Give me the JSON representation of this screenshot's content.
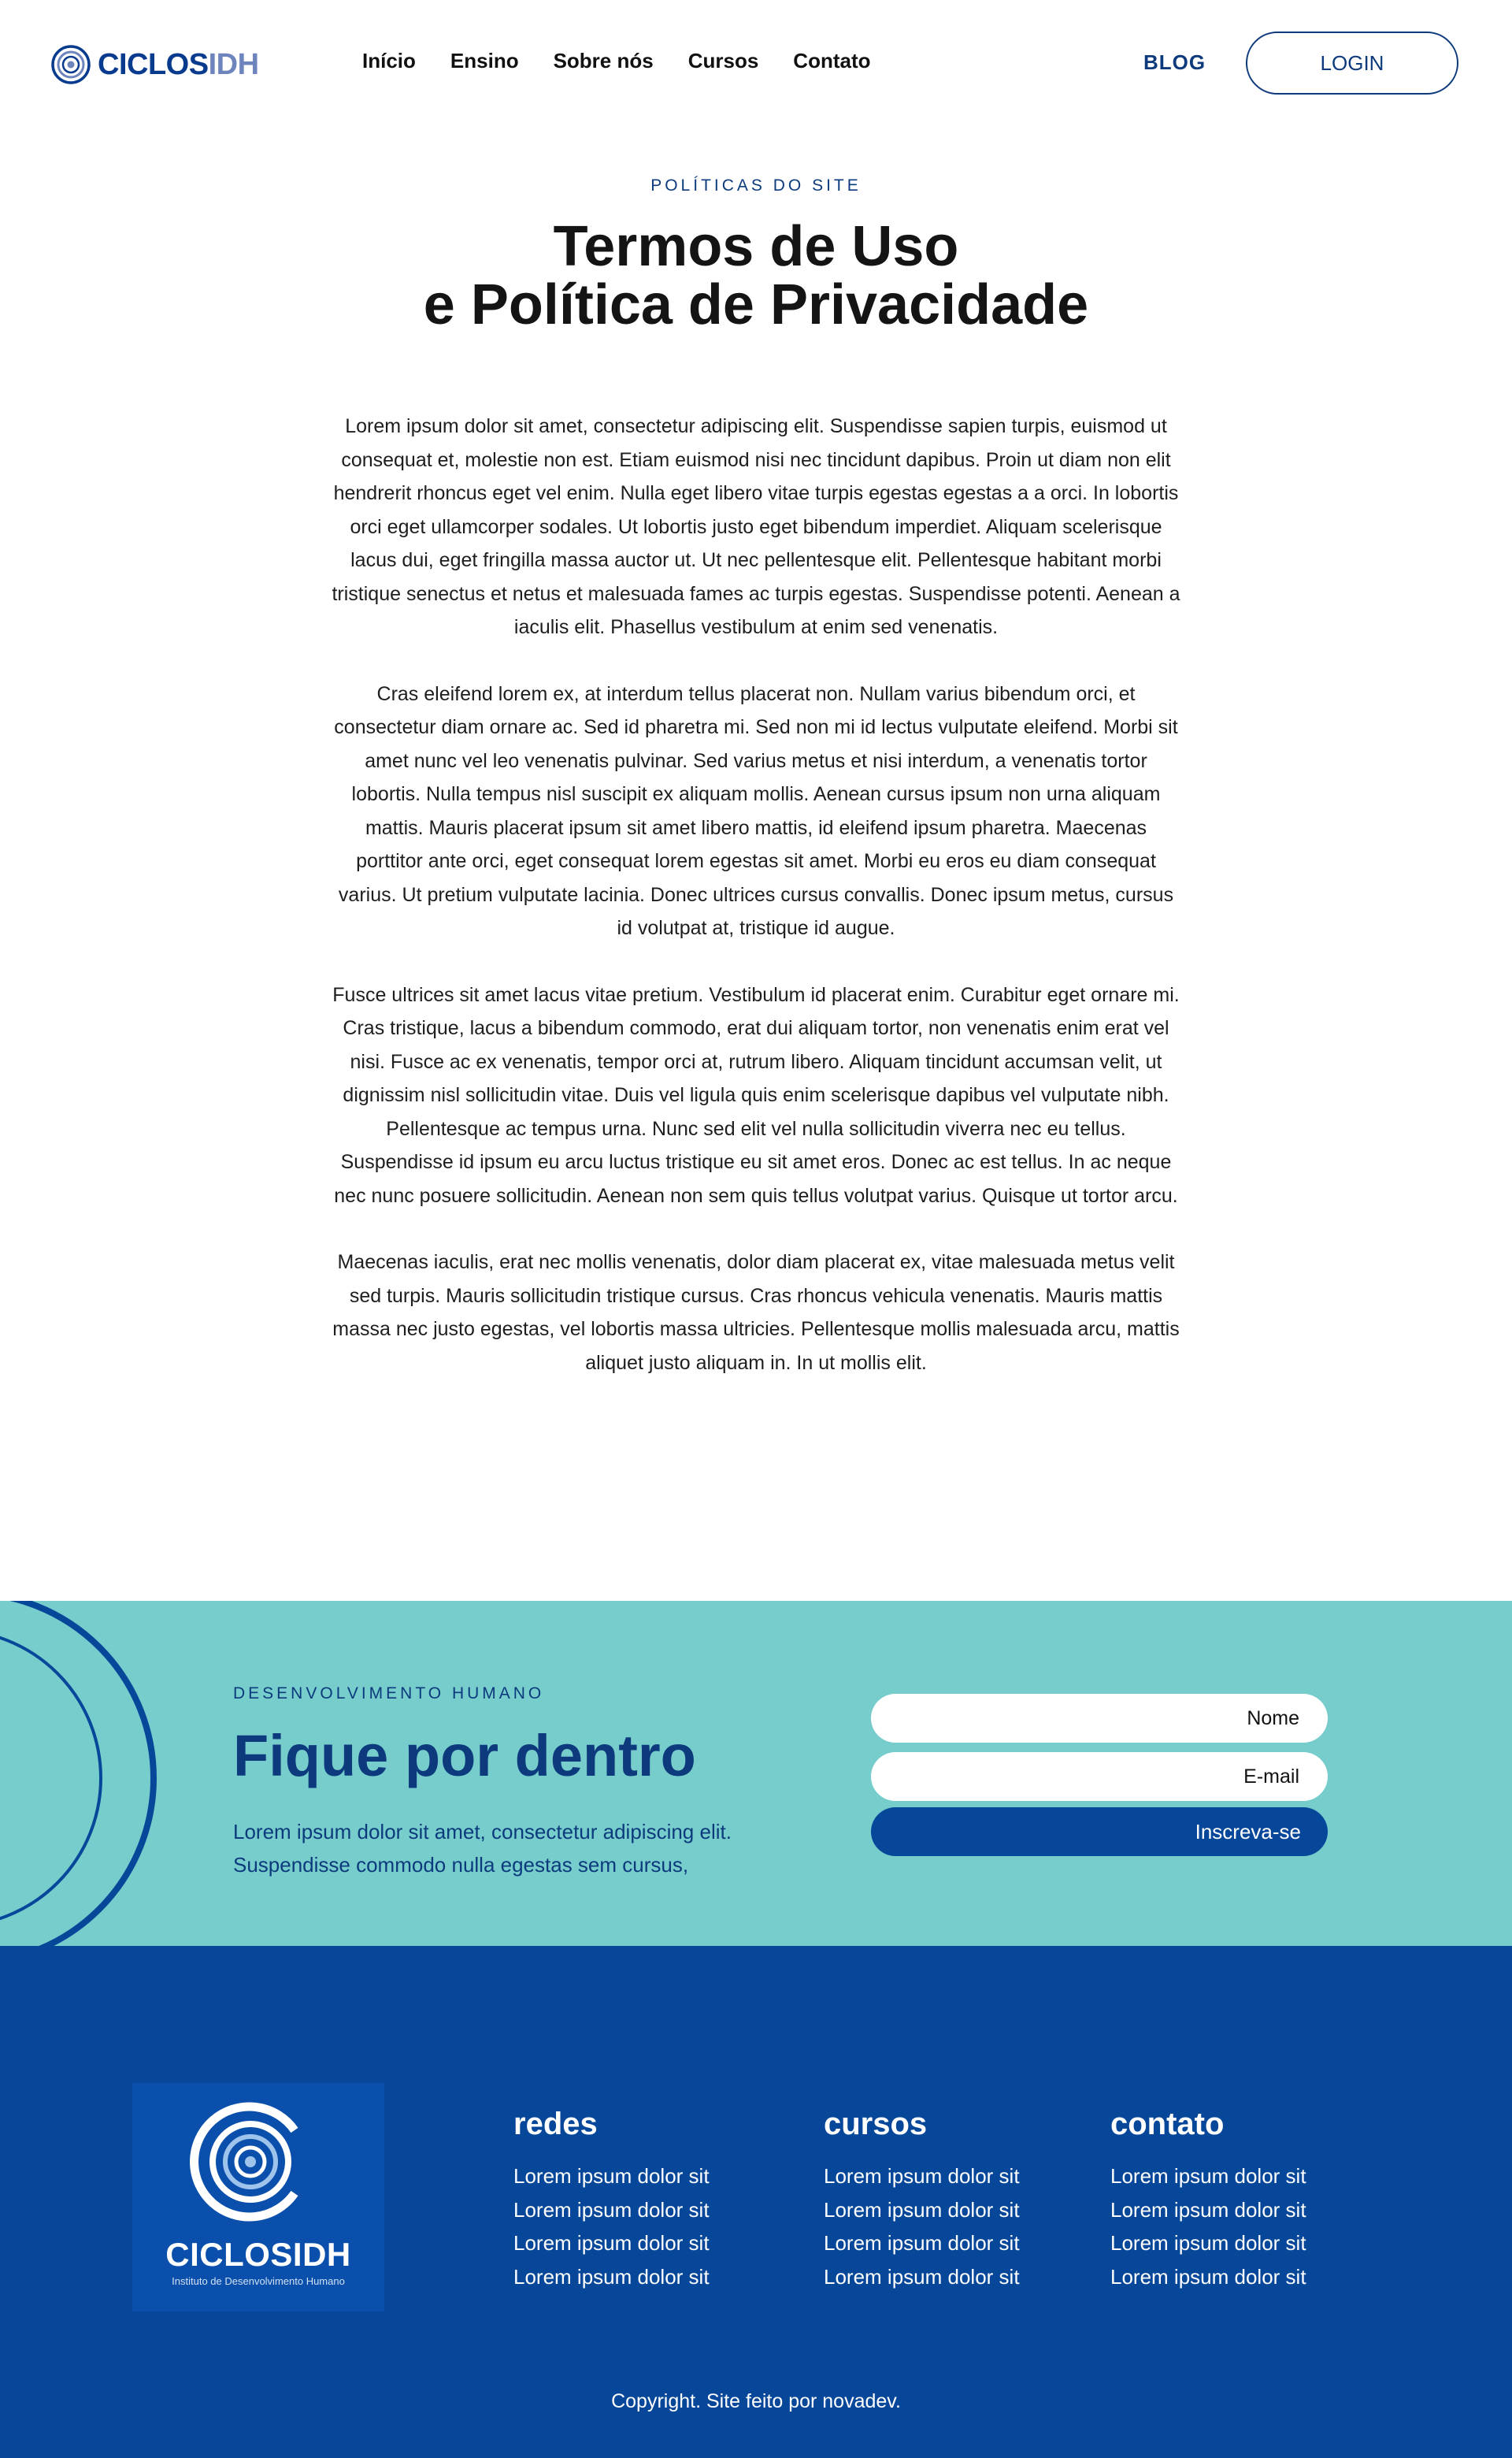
{
  "header": {
    "logo": {
      "primary": "CICLOS",
      "secondary": "IDH"
    },
    "nav": [
      "Início",
      "Ensino",
      "Sobre nós",
      "Cursos",
      "Contato"
    ],
    "blog_label": "BLOG",
    "login_label": "LOGIN"
  },
  "page": {
    "eyebrow": "POLÍTICAS DO SITE",
    "title_line1": "Termos de Uso",
    "title_line2": "e Política de Privacidade",
    "paragraphs": [
      "Lorem ipsum dolor sit amet, consectetur adipiscing elit. Suspendisse sapien turpis, euismod ut consequat et, molestie non est. Etiam euismod nisi nec tincidunt dapibus. Proin ut diam non elit hendrerit rhoncus eget vel enim. Nulla eget libero vitae turpis egestas egestas a a orci. In lobortis orci eget ullamcorper sodales. Ut lobortis justo eget bibendum imperdiet. Aliquam scelerisque lacus dui, eget fringilla massa auctor ut. Ut nec pellentesque elit. Pellentesque habitant morbi tristique senectus et netus et malesuada fames ac turpis egestas. Suspendisse potenti. Aenean a iaculis elit. Phasellus vestibulum at enim sed venenatis.",
      "Cras eleifend lorem ex, at interdum tellus placerat non. Nullam varius bibendum orci, et consectetur diam ornare ac. Sed id pharetra mi. Sed non mi id lectus vulputate eleifend. Morbi sit amet nunc vel leo venenatis pulvinar. Sed varius metus et nisi interdum, a venenatis tortor lobortis. Nulla tempus nisl suscipit ex aliquam mollis. Aenean cursus ipsum non urna aliquam mattis. Mauris placerat ipsum sit amet libero mattis, id eleifend ipsum pharetra. Maecenas porttitor ante orci, eget consequat lorem egestas sit amet. Morbi eu eros eu diam consequat varius. Ut pretium vulputate lacinia. Donec ultrices cursus convallis. Donec ipsum metus, cursus id volutpat at, tristique id augue.",
      "Fusce ultrices sit amet lacus vitae pretium. Vestibulum id placerat enim. Curabitur eget ornare mi. Cras tristique, lacus a bibendum commodo, erat dui aliquam tortor, non venenatis enim erat vel nisi. Fusce ac ex venenatis, tempor orci at, rutrum libero. Aliquam tincidunt accumsan velit, ut dignissim nisl sollicitudin vitae. Duis vel ligula quis enim scelerisque dapibus vel vulputate nibh. Pellentesque ac tempus urna. Nunc sed elit vel nulla sollicitudin viverra nec eu tellus. Suspendisse id ipsum eu arcu luctus tristique eu sit amet eros. Donec ac est tellus. In ac neque nec nunc posuere sollicitudin. Aenean non sem quis tellus volutpat varius. Quisque ut tortor arcu.",
      "Maecenas iaculis, erat nec mollis venenatis, dolor diam placerat ex, vitae malesuada metus velit sed turpis. Mauris sollicitudin tristique cursus. Cras rhoncus vehicula venenatis. Mauris mattis massa nec justo egestas, vel lobortis massa ultricies. Pellentesque mollis malesuada arcu, mattis aliquet justo aliquam in. In ut mollis elit."
    ]
  },
  "newsletter": {
    "eyebrow": "DESENVOLVIMENTO HUMANO",
    "title": "Fique por dentro",
    "description": "Lorem ipsum dolor sit amet, consectetur adipiscing elit. Suspendisse commodo nulla egestas sem cursus,",
    "name_placeholder": "Nome",
    "email_placeholder": "E-mail",
    "submit_label": "Inscreva-se"
  },
  "footer": {
    "logo_text": "CICLOSIDH",
    "logo_subtitle": "Instituto de Desenvolvimento Humano",
    "columns": [
      {
        "title": "redes",
        "items": [
          "Lorem ipsum dolor sit",
          "Lorem ipsum dolor sit",
          "Lorem ipsum dolor sit",
          "Lorem ipsum dolor sit"
        ]
      },
      {
        "title": "cursos",
        "items": [
          "Lorem ipsum dolor sit",
          "Lorem ipsum dolor sit",
          "Lorem ipsum dolor sit",
          "Lorem ipsum dolor sit"
        ]
      },
      {
        "title": "contato",
        "items": [
          "Lorem ipsum dolor sit",
          "Lorem ipsum dolor sit",
          "Lorem ipsum dolor sit",
          "Lorem ipsum dolor sit"
        ]
      }
    ],
    "copyright": "Copyright. Site feito por novadev."
  },
  "colors": {
    "brand_navy": "#0c3a7c",
    "brand_blue": "#06479a",
    "teal": "#76cdcc"
  },
  "icons": [
    "logo-spiral-icon",
    "decorative-arcs"
  ]
}
